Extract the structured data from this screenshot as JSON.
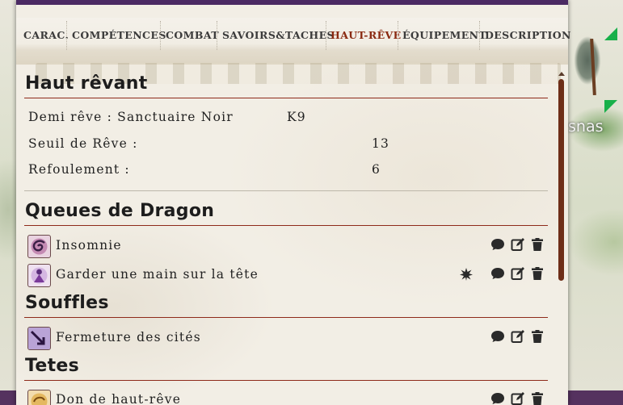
{
  "tabs": [
    {
      "label": "Carac."
    },
    {
      "label": "Compétences"
    },
    {
      "label": "Combat"
    },
    {
      "label": "Savoirs&Taches"
    },
    {
      "label": "Haut-rêve",
      "active": true
    },
    {
      "label": "Équipement"
    },
    {
      "label": "Description"
    }
  ],
  "haut_revant": {
    "title": "Haut rêvant",
    "demi_reve_label": "Demi rêve : Sanctuaire Noir",
    "demi_reve_value": "K9",
    "seuil_label": "Seuil de Rêve :",
    "seuil_value": "13",
    "refoulement_label": "Refoulement :",
    "refoulement_value": "6"
  },
  "queues": {
    "title": "Queues de Dragon",
    "items": [
      {
        "name": "Insomnie",
        "icon": "swirl-icon"
      },
      {
        "name": "Garder une main sur la tête",
        "icon": "figure-icon",
        "extra_icon": "burst-icon"
      }
    ]
  },
  "souffles": {
    "title": "Souffles",
    "items": [
      {
        "name": "Fermeture des cités",
        "icon": "arrow-icon"
      }
    ]
  },
  "tetes": {
    "title": "Tetes",
    "items": [
      {
        "name": "Don de haut-rêve",
        "icon": "head-icon"
      }
    ]
  },
  "map": {
    "label": "snas"
  },
  "colors": {
    "accent": "#8a2a12",
    "topbar": "#4b2a63",
    "rule": "#8e2a1a"
  }
}
